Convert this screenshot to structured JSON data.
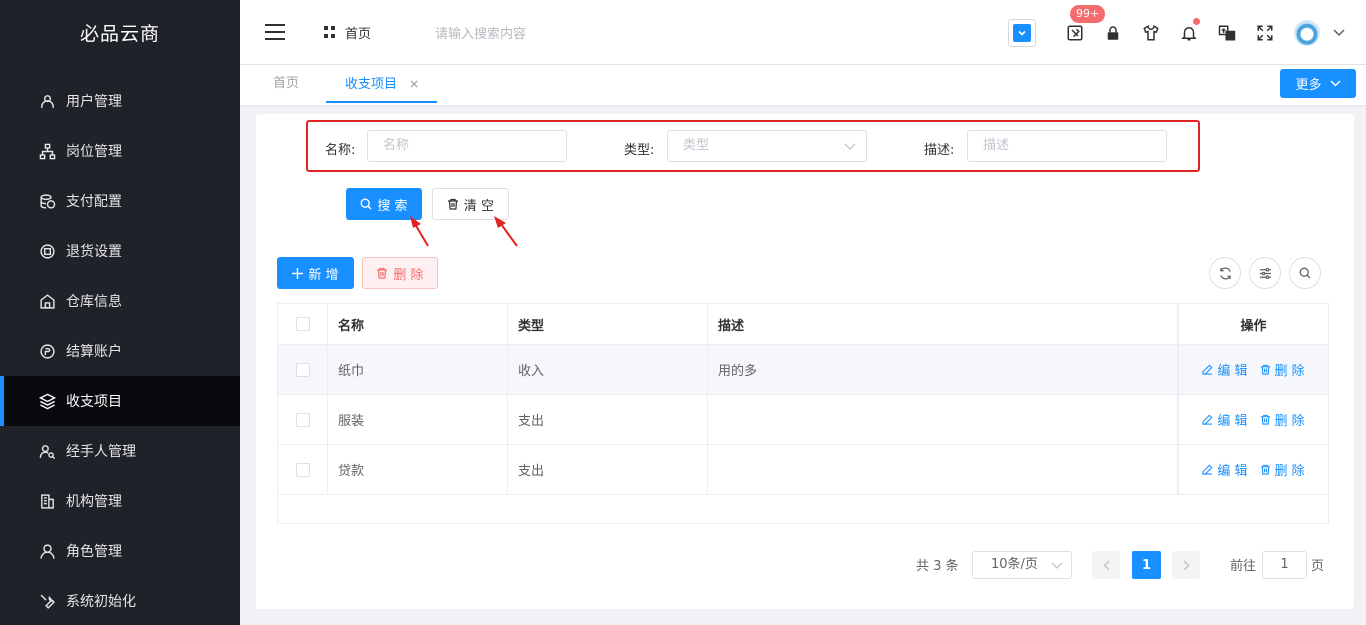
{
  "sidebar": {
    "brand": "必品云商",
    "items": [
      {
        "label": "用户管理"
      },
      {
        "label": "岗位管理"
      },
      {
        "label": "支付配置"
      },
      {
        "label": "退货设置"
      },
      {
        "label": "仓库信息"
      },
      {
        "label": "结算账户"
      },
      {
        "label": "收支项目"
      },
      {
        "label": "经手人管理"
      },
      {
        "label": "机构管理"
      },
      {
        "label": "角色管理"
      },
      {
        "label": "系统初始化"
      }
    ],
    "active_index": 6,
    "accent": "#1890ff"
  },
  "header": {
    "home_label": "首页",
    "search_placeholder": "请输入搜索内容",
    "badge_count": "99+",
    "icons": [
      "collapse-toggle-icon",
      "tools-icon",
      "lock-icon",
      "shirt-icon",
      "bell-icon",
      "translate-icon",
      "fullscreen-icon",
      "avatar",
      "chevron-down-icon"
    ]
  },
  "tabs": {
    "items": [
      {
        "label": "首页"
      },
      {
        "label": "收支项目",
        "close": "×"
      }
    ],
    "more_label": "更多"
  },
  "filters": {
    "name_label": "名称:",
    "name_placeholder": "名称",
    "type_label": "类型:",
    "type_placeholder": "类型",
    "desc_label": "描述:",
    "desc_placeholder": "描述"
  },
  "actions": {
    "search": "搜 索",
    "clear": "清 空",
    "add": "新 增",
    "delete": "删 除"
  },
  "table": {
    "headers": {
      "name": "名称",
      "type": "类型",
      "desc": "描述",
      "ops": "操作"
    },
    "rows": [
      {
        "name": "纸巾",
        "type": "收入",
        "desc": "用的多"
      },
      {
        "name": "服装",
        "type": "支出",
        "desc": ""
      },
      {
        "name": "贷款",
        "type": "支出",
        "desc": ""
      }
    ],
    "edit_label": "编 辑",
    "delete_label": "删 除"
  },
  "pagination": {
    "total": "共 3 条",
    "page_size": "10条/页",
    "current_page": "1",
    "goto_label": "前往",
    "goto_value": "1",
    "page_suffix": "页"
  },
  "colors": {
    "primary": "#1890ff",
    "danger": "#f56c6c",
    "annotation": "#e02424",
    "sidebar_bg": "#20222a"
  }
}
